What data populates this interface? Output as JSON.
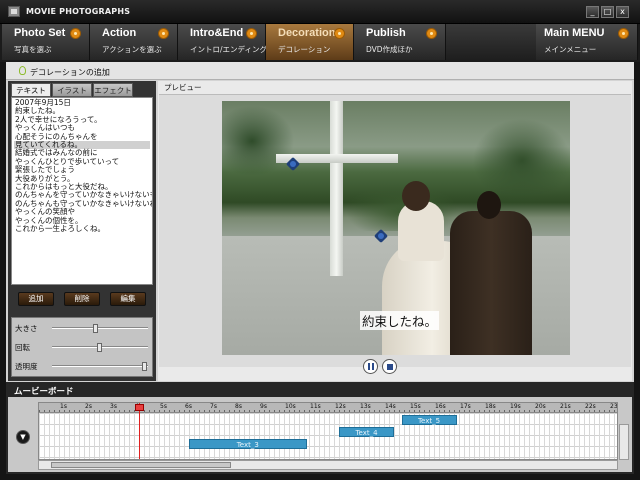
{
  "window": {
    "title": "MOVIE PHOTOGRAPHS",
    "controls": [
      "_",
      "□",
      "x"
    ]
  },
  "nav": [
    {
      "title": "Photo Set",
      "subtitle": "写真を選ぶ",
      "active": false
    },
    {
      "title": "Action",
      "subtitle": "アクションを選ぶ",
      "active": false
    },
    {
      "title": "Intro&End",
      "subtitle": "イントロ/エンディング",
      "active": false
    },
    {
      "title": "Decoration",
      "subtitle": "デコレーション",
      "active": true
    },
    {
      "title": "Publish",
      "subtitle": "DVD作成ほか",
      "active": false
    },
    {
      "title": "Main MENU",
      "subtitle": "メインメニュー",
      "active": false
    }
  ],
  "section": {
    "title": "デコレーションの追加"
  },
  "left_panel": {
    "tabs": [
      {
        "label": "テキスト",
        "active": true
      },
      {
        "label": "イラスト",
        "active": false
      },
      {
        "label": "エフェクト",
        "active": false
      }
    ],
    "text_lines": [
      "2007年9月15日",
      "約束したね。",
      "2人で幸せになろうって。",
      "やっくんはいつも",
      "心配そうにのんちゃんを",
      "見ていてくれるね。",
      "結婚式ではみんなの前に",
      "やっくんひとりで歩いていって",
      "緊張したでしょう",
      "大役ありがとう。",
      "これからはもっと大役だね。",
      "のんちゃんを守っていかなきゃいけないもんね。",
      "のんちゃんも守っていかなきゃいけないね。",
      "やっくんの笑顔や",
      "やっくんの個性を。",
      "これから一生よろしくね。"
    ],
    "selected_line_index": 5,
    "buttons": {
      "add": "追加",
      "delete": "削除",
      "edit": "編集"
    },
    "sliders": [
      {
        "label": "大きさ",
        "value": 0.45
      },
      {
        "label": "回転",
        "value": 0.5
      },
      {
        "label": "透明度",
        "value": 1.0
      }
    ]
  },
  "preview": {
    "label": "プレビュー",
    "caption": "約束したね。",
    "controls": {
      "pause": "pause-icon",
      "stop": "stop-icon"
    }
  },
  "movie_board": {
    "title": "ムービーボード",
    "ticks": [
      "1s",
      "2s",
      "3s",
      "4s",
      "5s",
      "6s",
      "7s",
      "8s",
      "9s",
      "10s",
      "11s",
      "12s",
      "13s",
      "14s",
      "15s",
      "16s",
      "17s",
      "18s",
      "19s",
      "20s",
      "21s",
      "22s",
      "23s"
    ],
    "clips": [
      {
        "label": "Text_5",
        "start_s": 14.5,
        "end_s": 16.7,
        "track": 0
      },
      {
        "label": "Text_4",
        "start_s": 12.0,
        "end_s": 14.2,
        "track": 1
      },
      {
        "label": "Text_3",
        "start_s": 6.0,
        "end_s": 10.7,
        "track": 2
      }
    ],
    "playhead_s": 4.0
  },
  "colors": {
    "accent_active": "#a8793e",
    "nav_dot": "#e08a13",
    "clip": "#3a97c6",
    "playhead": "#e02020"
  }
}
